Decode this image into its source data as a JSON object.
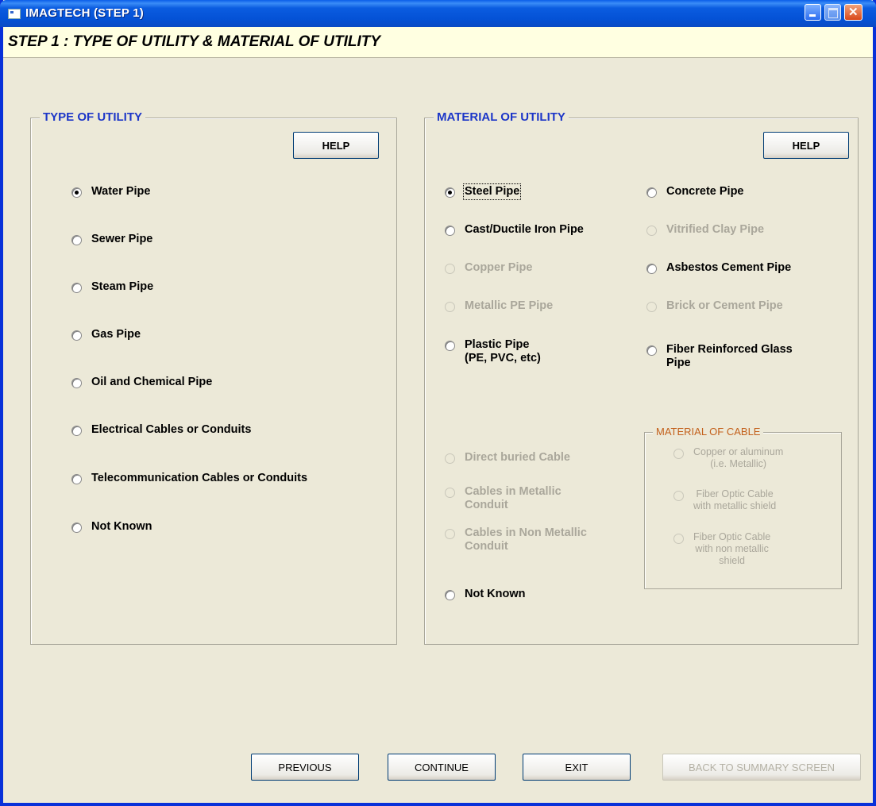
{
  "window": {
    "title": "IMAGTECH (STEP 1)"
  },
  "step_header": "STEP 1 :  TYPE OF UTILITY & MATERIAL OF UTILITY",
  "type_of_utility": {
    "legend": "TYPE OF UTILITY",
    "help_label": "HELP",
    "options": [
      {
        "label": "Water Pipe",
        "selected": true
      },
      {
        "label": "Sewer Pipe",
        "selected": false
      },
      {
        "label": "Steam Pipe",
        "selected": false
      },
      {
        "label": "Gas Pipe",
        "selected": false
      },
      {
        "label": "Oil and Chemical Pipe",
        "selected": false
      },
      {
        "label": "Electrical Cables or Conduits",
        "selected": false
      },
      {
        "label": "Telecommunication Cables or Conduits",
        "selected": false
      },
      {
        "label": "Not Known",
        "selected": false
      }
    ]
  },
  "material_of_utility": {
    "legend": "MATERIAL OF UTILITY",
    "help_label": "HELP",
    "left_options": [
      {
        "label": "Steel Pipe",
        "selected": true,
        "enabled": true
      },
      {
        "label": "Cast/Ductile Iron Pipe",
        "selected": false,
        "enabled": true
      },
      {
        "label": "Copper Pipe",
        "selected": false,
        "enabled": false
      },
      {
        "label": "Metallic PE Pipe",
        "selected": false,
        "enabled": false
      },
      {
        "label": "Plastic Pipe\n(PE, PVC, etc)",
        "selected": false,
        "enabled": true
      },
      {
        "label": "Direct buried Cable",
        "selected": false,
        "enabled": false
      },
      {
        "label": "Cables in Metallic\nConduit",
        "selected": false,
        "enabled": false
      },
      {
        "label": "Cables in Non Metallic\nConduit",
        "selected": false,
        "enabled": false
      },
      {
        "label": "Not Known",
        "selected": false,
        "enabled": true
      }
    ],
    "right_options": [
      {
        "label": "Concrete Pipe",
        "selected": false,
        "enabled": true
      },
      {
        "label": "Vitrified Clay Pipe",
        "selected": false,
        "enabled": false
      },
      {
        "label": "Asbestos Cement Pipe",
        "selected": false,
        "enabled": true
      },
      {
        "label": "Brick or Cement Pipe",
        "selected": false,
        "enabled": false
      },
      {
        "label": "Fiber Reinforced Glass\nPipe",
        "selected": false,
        "enabled": true
      }
    ]
  },
  "material_of_cable": {
    "legend": "MATERIAL OF CABLE",
    "options": [
      {
        "label": "Copper or aluminum\n(i.e. Metallic)",
        "selected": false,
        "enabled": false
      },
      {
        "label": "Fiber Optic Cable\nwith metallic shield",
        "selected": false,
        "enabled": false
      },
      {
        "label": "Fiber Optic Cable\nwith non metallic\nshield",
        "selected": false,
        "enabled": false
      }
    ]
  },
  "footer_buttons": {
    "previous": "PREVIOUS",
    "continue": "CONTINUE",
    "exit": "EXIT",
    "back_to_summary": "BACK TO SUMMARY SCREEN"
  }
}
